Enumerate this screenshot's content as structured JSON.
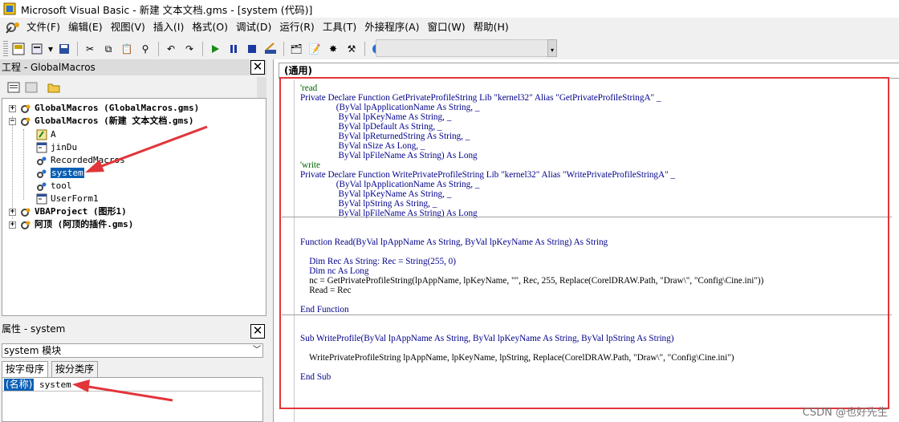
{
  "window": {
    "title": "Microsoft Visual Basic - 新建 文本文档.gms - [system (代码)]"
  },
  "menu": [
    "文件(F)",
    "编辑(E)",
    "视图(V)",
    "插入(I)",
    "格式(O)",
    "调试(D)",
    "运行(R)",
    "工具(T)",
    "外接程序(A)",
    "窗口(W)",
    "帮助(H)"
  ],
  "project": {
    "title": "工程 - GlobalMacros",
    "close": "✕",
    "tree": [
      {
        "label": "GlobalMacros (GlobalMacros.gms)",
        "expander": "+"
      },
      {
        "label": "GlobalMacros (新建 文本文档.gms)",
        "expander": "−"
      },
      {
        "label": "A"
      },
      {
        "label": "jinDu"
      },
      {
        "label": "RecordedMacros"
      },
      {
        "label": "system"
      },
      {
        "label": "tool"
      },
      {
        "label": "UserForm1"
      },
      {
        "label": "VBAProject (图形1)",
        "expander": "+"
      },
      {
        "label": "阿顶 (阿顶的插件.gms)",
        "expander": "+"
      }
    ]
  },
  "properties": {
    "title": "属性 - system",
    "close": "✕",
    "combo_value": "system 模块",
    "tabs": [
      "按字母序",
      "按分类序"
    ],
    "row_name": "(名称)",
    "row_value": "system"
  },
  "code": {
    "object_combo": "(通用)",
    "lines": [
      "'read",
      "Private Declare Function GetPrivateProfileString Lib \"kernel32\" Alias \"GetPrivateProfileStringA\" _",
      "                (ByVal lpApplicationName As String, _",
      "                 ByVal lpKeyName As String, _",
      "                 ByVal lpDefault As String, _",
      "                 ByVal lpReturnedString As String, _",
      "                 ByVal nSize As Long, _",
      "                 ByVal lpFileName As String) As Long",
      "'write",
      "Private Declare Function WritePrivateProfileString Lib \"kernel32\" Alias \"WritePrivateProfileStringA\" _",
      "                (ByVal lpApplicationName As String, _",
      "                 ByVal lpKeyName As String, _",
      "                 ByVal lpString As String, _",
      "                 ByVal lpFileName As String) As Long",
      "Function Read(ByVal lpAppName As String, ByVal lpKeyName As String) As String",
      "    Dim Rec As String: Rec = String(255, 0)",
      "    Dim nc As Long",
      "    nc = GetPrivateProfileString(lpAppName, lpKeyName, \"\", Rec, 255, Replace(CorelDRAW.Path, \"Draw\\\", \"Config\\Cine.ini\"))",
      "    Read = Rec",
      "End Function",
      "Sub WriteProfile(ByVal lpAppName As String, ByVal lpKeyName As String, ByVal lpString As String)",
      "    WritePrivateProfileString lpAppName, lpKeyName, lpString, Replace(CorelDRAW.Path, \"Draw\\\", \"Config\\Cine.ini\")",
      "End Sub"
    ]
  },
  "watermark": "CSDN @也好先生",
  "colors": {
    "selection": "#0a5fb4",
    "annotation": "#e2353a",
    "comment": "#006400",
    "keyword": "#00008b"
  }
}
